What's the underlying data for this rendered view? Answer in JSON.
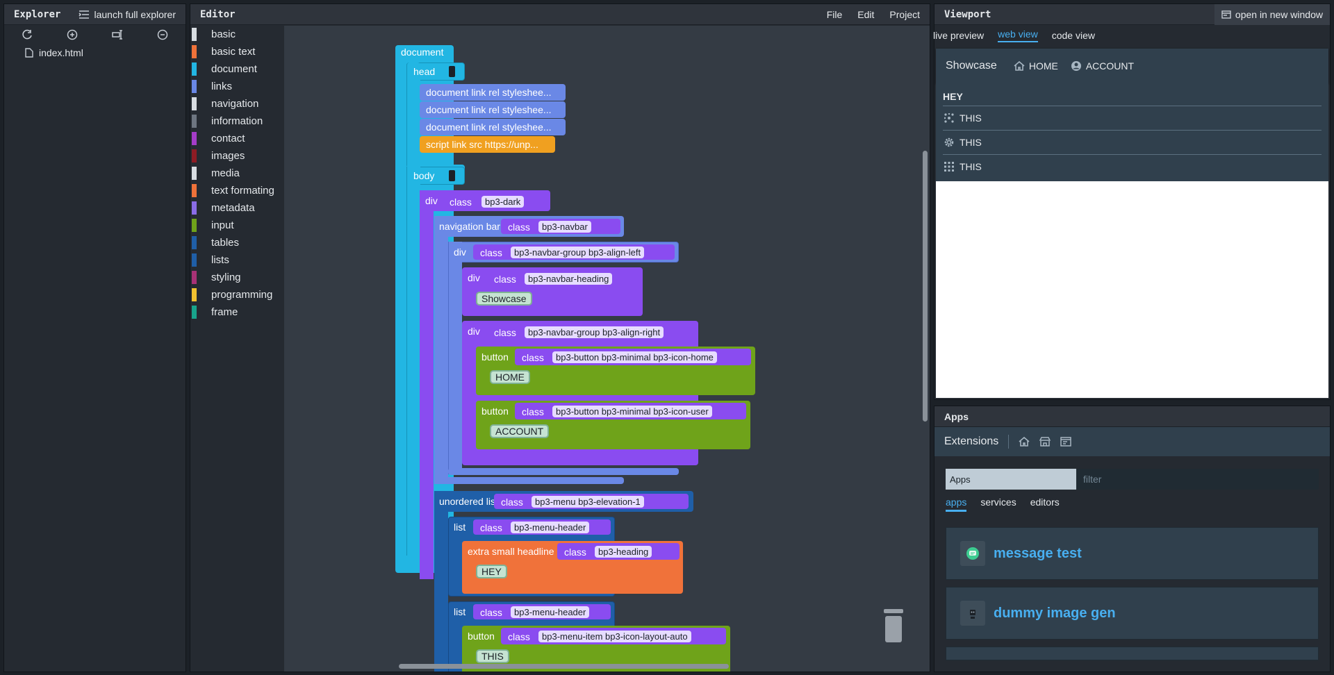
{
  "explorer": {
    "title": "Explorer",
    "launch_label": "launch full explorer",
    "file": "index.html"
  },
  "editor": {
    "title": "Editor",
    "menu": [
      "File",
      "Edit",
      "Project"
    ],
    "categories": [
      {
        "label": "basic",
        "color": "#d8dde2"
      },
      {
        "label": "basic text",
        "color": "#f0723a"
      },
      {
        "label": "document",
        "color": "#22b6e3"
      },
      {
        "label": "links",
        "color": "#6a88e6"
      },
      {
        "label": "navigation",
        "color": "#d8dde2"
      },
      {
        "label": "information",
        "color": "#6e7681"
      },
      {
        "label": "contact",
        "color": "#a43cc8"
      },
      {
        "label": "images",
        "color": "#8e1c24"
      },
      {
        "label": "media",
        "color": "#d8dde2"
      },
      {
        "label": "text formating",
        "color": "#f0723a"
      },
      {
        "label": "metadata",
        "color": "#8a6ce6"
      },
      {
        "label": "input",
        "color": "#6fa31a"
      },
      {
        "label": "tables",
        "color": "#1f5fa8"
      },
      {
        "label": "lists",
        "color": "#1f5fa8"
      },
      {
        "label": "styling",
        "color": "#a83276"
      },
      {
        "label": "programming",
        "color": "#f2c230"
      },
      {
        "label": "frame",
        "color": "#18a48c"
      }
    ],
    "blocks": {
      "document": "document",
      "head": "head",
      "link1": "document link rel styleshee...",
      "link2": "document link rel styleshee...",
      "link3": "document link rel styleshee...",
      "script": "script link src https://unp...",
      "body": "body",
      "div1": "div",
      "class_label": "class",
      "div1_class": "bp3-dark",
      "navbar": "navigation bar",
      "navbar_class": "bp3-navbar",
      "div2": "div",
      "div2_class": "bp3-navbar-group bp3-align-left",
      "div3": "div",
      "div3_class": "bp3-navbar-heading",
      "showcase": "Showcase",
      "div4": "div",
      "div4_class": "bp3-navbar-group bp3-align-right",
      "button1": "button",
      "button1_class": "bp3-button bp3-minimal bp3-icon-home",
      "home": "HOME",
      "button2": "button",
      "button2_class": "bp3-button bp3-minimal bp3-icon-user",
      "account": "ACCOUNT",
      "ul": "unordered list",
      "ul_class": "bp3-menu bp3-elevation-1",
      "list1": "list",
      "list1_class": "bp3-menu-header",
      "xsh": "extra small headline",
      "xsh_class": "bp3-heading",
      "hey": "HEY",
      "list2": "list",
      "list2_class": "bp3-menu-header",
      "button3": "button",
      "button3_class": "bp3-menu-item bp3-icon-layout-auto",
      "this": "THIS"
    }
  },
  "viewport": {
    "title": "Viewport",
    "open_label": "open in new window",
    "tabs": [
      "live preview",
      "web view",
      "code view"
    ],
    "site": {
      "brand": "Showcase",
      "home": "HOME",
      "account": "ACCOUNT",
      "header": "HEY",
      "items": [
        "THIS",
        "THIS",
        "THIS"
      ]
    }
  },
  "apps": {
    "title": "Apps",
    "extensions_label": "Extensions",
    "select_value": "Apps",
    "filter_placeholder": "filter",
    "tabs": [
      "apps",
      "services",
      "editors"
    ],
    "cards": [
      "message test",
      "dummy image gen"
    ]
  }
}
